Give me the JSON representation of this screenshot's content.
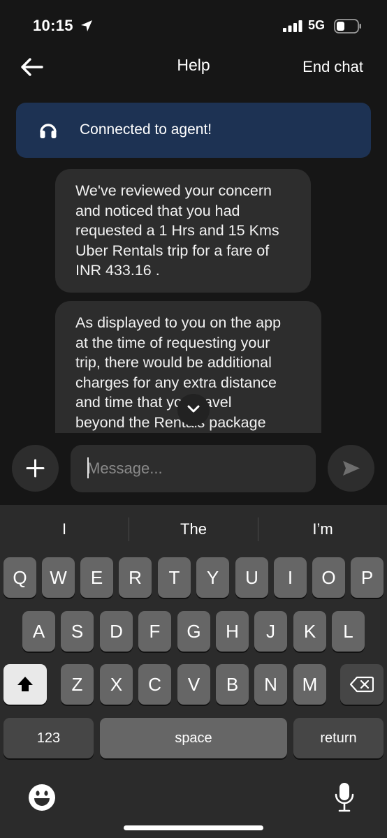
{
  "status_bar": {
    "time": "10:15",
    "network": "5G"
  },
  "header": {
    "title": "Help",
    "end_chat": "End chat"
  },
  "banner": {
    "text": "Connected to agent!",
    "color": "#1d3253"
  },
  "messages": [
    {
      "lines": [
        "We've reviewed your concern",
        "and noticed that you had",
        "requested a 1 Hrs and 15 Kms",
        "Uber Rentals trip for a fare of",
        "INR 433.16 ."
      ]
    },
    {
      "lines": [
        "As displayed to you on the app",
        "at the time of requesting your",
        "trip, there would be additional",
        "charges for any extra distance",
        "and time that you travel",
        "beyond the Rentals package"
      ]
    }
  ],
  "composer": {
    "placeholder": "Message..."
  },
  "keyboard": {
    "suggestions": [
      "I",
      "The",
      "I’m"
    ],
    "row1": [
      "Q",
      "W",
      "E",
      "R",
      "T",
      "Y",
      "U",
      "I",
      "O",
      "P"
    ],
    "row2": [
      "A",
      "S",
      "D",
      "F",
      "G",
      "H",
      "J",
      "K",
      "L"
    ],
    "row3": [
      "Z",
      "X",
      "C",
      "V",
      "B",
      "N",
      "M"
    ],
    "numbers_key": "123",
    "space_key": "space",
    "return_key": "return"
  },
  "colors": {
    "background": "#161616",
    "bubble": "#2d2d2d",
    "keyboard": "#2b2b2b",
    "key": "#666666"
  }
}
